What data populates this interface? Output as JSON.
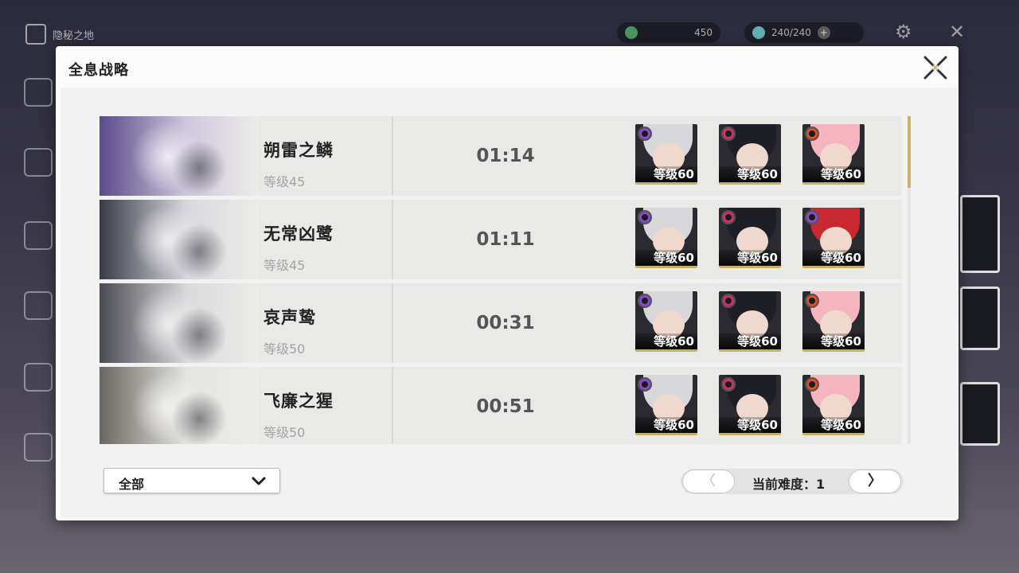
{
  "background": {
    "home_label": "隐秘之地",
    "resource_1": "450",
    "resource_2": "240/240"
  },
  "modal": {
    "title": "全息战略"
  },
  "rows": [
    {
      "boss_name": "朔雷之鳞",
      "boss_level": "等级45",
      "time": "01:14",
      "characters": [
        {
          "level": "等级60",
          "hair": "#d8d8dc",
          "element": "#8a4ad0"
        },
        {
          "level": "等级60",
          "hair": "#1e1e26",
          "element": "#d0306a"
        },
        {
          "level": "等级60",
          "hair": "#f4b4c0",
          "element": "#e05020"
        }
      ]
    },
    {
      "boss_name": "无常凶鹭",
      "boss_level": "等级45",
      "time": "01:11",
      "characters": [
        {
          "level": "等级60",
          "hair": "#d8d8dc",
          "element": "#8a4ad0"
        },
        {
          "level": "等级60",
          "hair": "#1e1e26",
          "element": "#d0306a"
        },
        {
          "level": "等级60",
          "hair": "#c82830",
          "element": "#8a4ad0"
        }
      ]
    },
    {
      "boss_name": "哀声鸷",
      "boss_level": "等级50",
      "time": "00:31",
      "characters": [
        {
          "level": "等级60",
          "hair": "#d8d8dc",
          "element": "#8a4ad0"
        },
        {
          "level": "等级60",
          "hair": "#1e1e26",
          "element": "#d0306a"
        },
        {
          "level": "等级60",
          "hair": "#f4b4c0",
          "element": "#e05020"
        }
      ]
    },
    {
      "boss_name": "飞廉之猩",
      "boss_level": "等级50",
      "time": "00:51",
      "characters": [
        {
          "level": "等级60",
          "hair": "#d8d8dc",
          "element": "#8a4ad0"
        },
        {
          "level": "等级60",
          "hair": "#1e1e26",
          "element": "#d0306a"
        },
        {
          "level": "等级60",
          "hair": "#f4b4c0",
          "element": "#e05020"
        }
      ]
    }
  ],
  "filter": {
    "selected": "全部"
  },
  "pager": {
    "prev_symbol": "〈",
    "next_symbol": "〉",
    "label": "当前难度：1"
  },
  "colors": {
    "accent_gold": "#c8b070",
    "panel_bg": "#fbfbfb"
  }
}
